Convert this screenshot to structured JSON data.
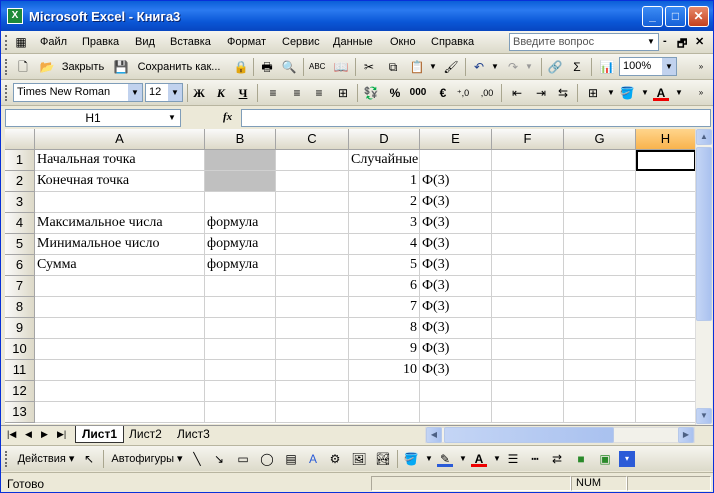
{
  "window": {
    "title": "Microsoft Excel - Книга3",
    "app_icon": "X",
    "min": "_",
    "max": "□",
    "close": "✕"
  },
  "menu": {
    "items": [
      "Файл",
      "Правка",
      "Вид",
      "Вставка",
      "Формат",
      "Сервис",
      "Данные",
      "Окно",
      "Справка"
    ],
    "search_placeholder": "Введите вопрос",
    "mdi_min": "-",
    "mdi_restore": "🗗",
    "mdi_close": "✕"
  },
  "standard_toolbar": {
    "open_label": "Закрыть",
    "save_label": "Сохранить как...",
    "zoom": "100%"
  },
  "format_toolbar": {
    "font": "Times New Roman",
    "size": "12",
    "bold": "Ж",
    "italic": "К",
    "underline": "Ч",
    "percent": "%",
    "thousands": "000",
    "currency": "€"
  },
  "formula_bar": {
    "name_box": "H1",
    "fx": "fx",
    "content": ""
  },
  "grid": {
    "columns": [
      "A",
      "B",
      "C",
      "D",
      "E",
      "F",
      "G",
      "H"
    ],
    "selected_column": "H",
    "rows": [
      "1",
      "2",
      "3",
      "4",
      "5",
      "6",
      "7",
      "8",
      "9",
      "10",
      "11",
      "12",
      "13"
    ],
    "cells": {
      "A1": "Начальная точка",
      "A2": "Конечная точка",
      "A4": "Максимальное числа",
      "A5": "Минимальное число",
      "A6": "Сумма",
      "B4": "формула",
      "B5": "формула",
      "B6": "формула",
      "D1": "Случайные числа",
      "D2": "1",
      "D3": "2",
      "D4": "3",
      "D5": "4",
      "D6": "5",
      "D7": "6",
      "D8": "7",
      "D9": "8",
      "D10": "9",
      "D11": "10",
      "E2": "Ф(3)",
      "E3": "Ф(3)",
      "E4": "Ф(3)",
      "E5": "Ф(3)",
      "E6": "Ф(3)",
      "E7": "Ф(3)",
      "E8": "Ф(3)",
      "E9": "Ф(3)",
      "E10": "Ф(3)",
      "E11": "Ф(3)"
    },
    "shaded_fill": "#c0c0c0"
  },
  "sheets": {
    "tabs": [
      "Лист1",
      "Лист2",
      "Лист3"
    ],
    "active": "Лист1"
  },
  "draw_toolbar": {
    "actions": "Действия",
    "autoshapes": "Автофигуры"
  },
  "status": {
    "text": "Готово",
    "num": "NUM"
  }
}
